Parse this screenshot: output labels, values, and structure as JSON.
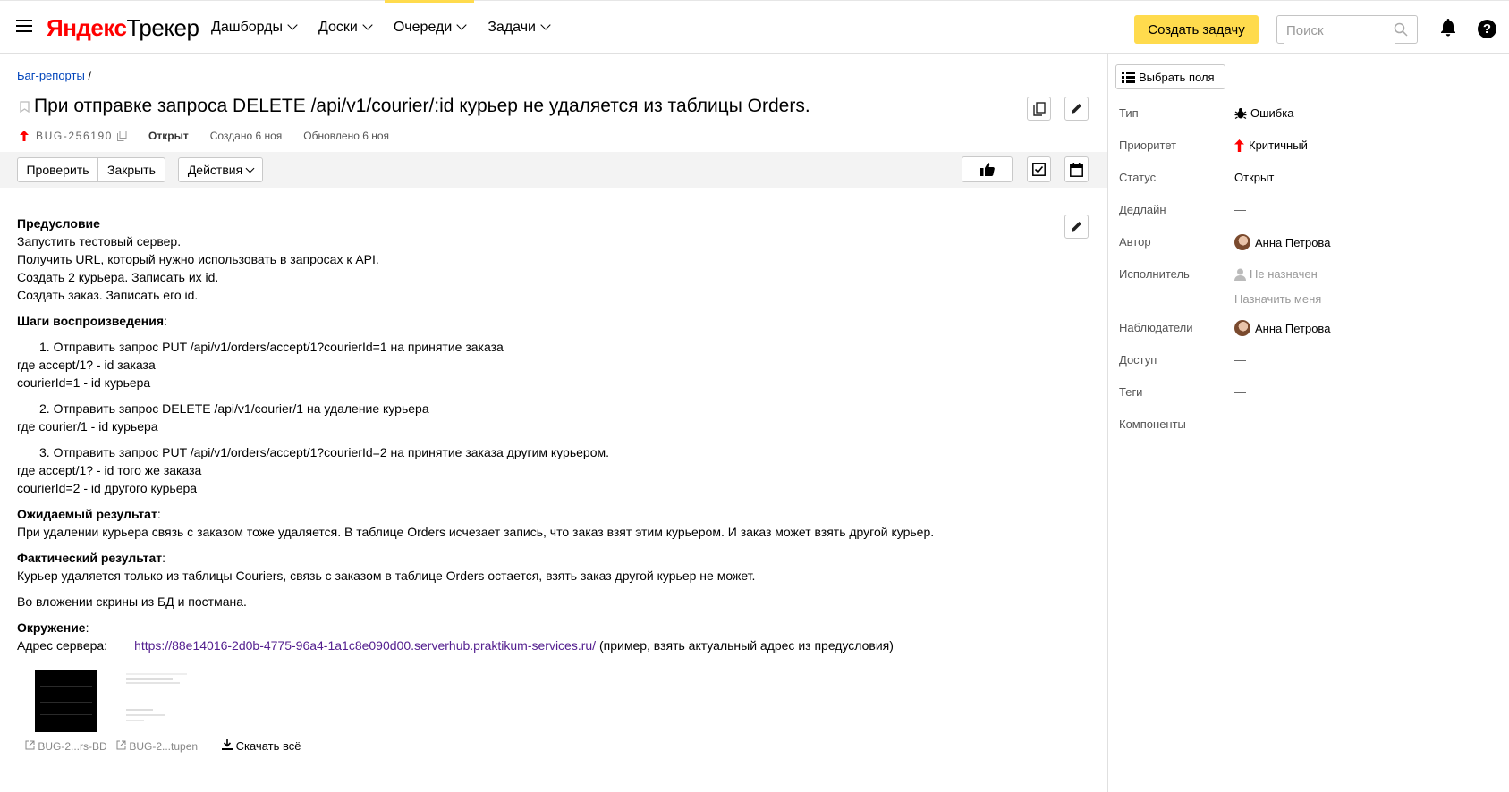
{
  "app": {
    "logo_ya": "Яндекс",
    "logo_tracker": "Трекер"
  },
  "nav": {
    "items": [
      "Дашборды",
      "Доски",
      "Очереди",
      "Задачи"
    ],
    "active": "Очереди"
  },
  "header": {
    "create_label": "Создать задачу",
    "search_placeholder": "Поиск",
    "help_label": "?"
  },
  "issue": {
    "breadcrumb": "Баг-репорты",
    "breadcrumb_sep": "/",
    "title": "При отправке запроса DELETE /api/v1/courier/:id курьер не удаляется из таблицы Orders.",
    "key": "BUG-256190",
    "status": "Открыт",
    "created": "Создано 6 ноя",
    "updated": "Обновлено 6 ноя"
  },
  "toolbar": {
    "check": "Проверить",
    "close": "Закрыть",
    "actions": "Действия"
  },
  "description": {
    "precondition_title": "Предусловие",
    "precondition": [
      "Запустить тестовый сервер.",
      "Получить URL, который нужно использовать в запросах к API.",
      "Создать 2 курьера. Записать их id.",
      "Создать заказ. Записать его id."
    ],
    "steps_title": "Шаги воспроизведения",
    "step1": "1. Отправить запрос PUT /api/v1/orders/accept/1?courierId=1 на принятие заказа",
    "step1_notes": [
      "где accept/1? - id заказа",
      "courierId=1 - id курьера"
    ],
    "step2": "2. Отправить запрос DELETE /api/v1/courier/1 на удаление курьера",
    "step2_notes": [
      "где courier/1 - id курьера"
    ],
    "step3": "3. Отправить запрос PUT /api/v1/orders/accept/1?courierId=2 на принятие заказа другим курьером.",
    "step3_notes": [
      "где accept/1? - id того же заказа",
      "courierId=2 - id другого курьера"
    ],
    "expected_title": "Ожидаемый результат",
    "expected": "При удалении курьера связь с заказом тоже удаляется. В таблице Orders исчезает запись, что заказ взят этим курьером. И заказ может взять другой курьер.",
    "actual_title": "Фактический результат",
    "actual": "Курьер удаляется только из таблицы Couriers, связь с заказом в таблице Orders остается, взять заказ другой курьер не может.",
    "attachments_note": "Во вложении скрины из БД и постмана.",
    "env_title": "Окружение",
    "server_label": "Адрес сервера:",
    "server_url": "https://88e14016-2d0b-4775-96a4-1a1c8e090d00.serverhub.praktikum-services.ru/",
    "server_note": "(пример, взять актуальный адрес из предусловия)",
    "colon": ":"
  },
  "attachments": [
    {
      "name": "BUG-2...rs-BD"
    },
    {
      "name": "BUG-2...tupen"
    }
  ],
  "download_all": "Скачать всё",
  "sidebar": {
    "select_fields": "Выбрать поля",
    "fields": [
      {
        "label": "Тип",
        "value": "Ошибка"
      },
      {
        "label": "Приоритет",
        "value": "Критичный"
      },
      {
        "label": "Статус",
        "value": "Открыт"
      },
      {
        "label": "Дедлайн",
        "value": "—"
      },
      {
        "label": "Автор",
        "value": "Анна Петрова"
      },
      {
        "label": "Исполнитель",
        "value": "Не назначен",
        "extra": "Назначить меня"
      },
      {
        "label": "Наблюдатели",
        "value": "Анна Петрова"
      },
      {
        "label": "Доступ",
        "value": "—"
      },
      {
        "label": "Теги",
        "value": "—"
      },
      {
        "label": "Компоненты",
        "value": "—"
      }
    ]
  },
  "colors": {
    "accent": "#ffdb4d",
    "link": "#0044bb",
    "visited_link": "#521d8e",
    "priority_critical": "#ff0000"
  }
}
